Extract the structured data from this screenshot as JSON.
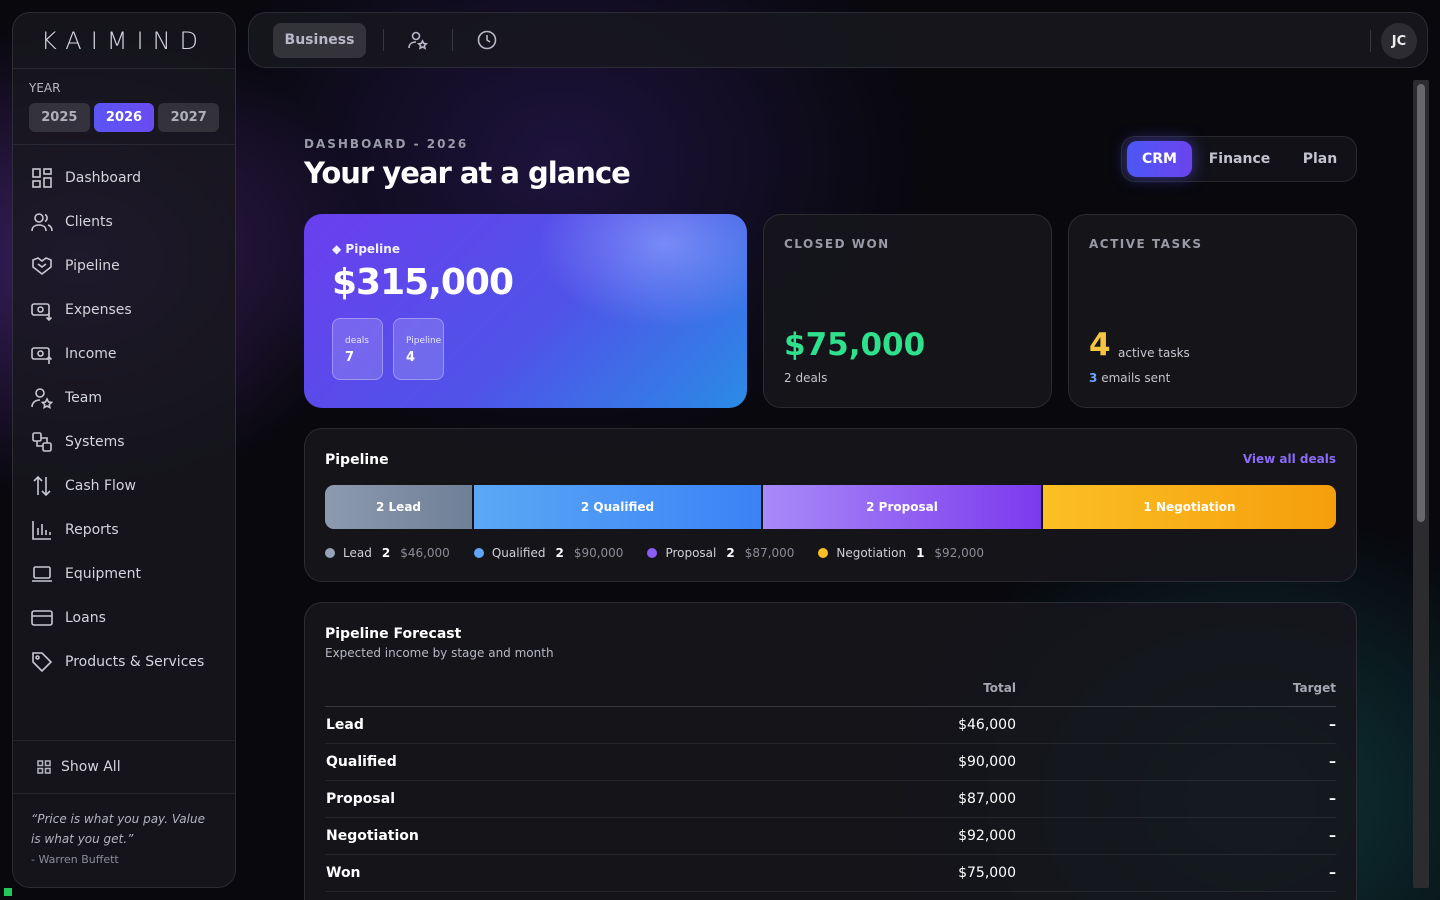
{
  "brand": "KAIMIND",
  "year": {
    "label": "YEAR",
    "options": [
      "2025",
      "2026",
      "2027"
    ],
    "selected": "2026"
  },
  "sidebar": {
    "items": [
      {
        "label": "Dashboard",
        "icon": "grid-icon"
      },
      {
        "label": "Clients",
        "icon": "users-icon"
      },
      {
        "label": "Pipeline",
        "icon": "handshake-icon"
      },
      {
        "label": "Expenses",
        "icon": "cash-out-icon"
      },
      {
        "label": "Income",
        "icon": "cash-in-icon"
      },
      {
        "label": "Team",
        "icon": "team-icon"
      },
      {
        "label": "Systems",
        "icon": "systems-icon"
      },
      {
        "label": "Cash Flow",
        "icon": "arrows-updown-icon"
      },
      {
        "label": "Reports",
        "icon": "bar-chart-icon"
      },
      {
        "label": "Equipment",
        "icon": "laptop-icon"
      },
      {
        "label": "Loans",
        "icon": "credit-card-icon"
      },
      {
        "label": "Products & Services",
        "icon": "tag-icon"
      }
    ],
    "show_all": "Show All",
    "quote": "“Price is what you pay. Value is what you get.”",
    "quote_author": "- Warren Buffett"
  },
  "topbar": {
    "business": "Business",
    "avatar": "JC"
  },
  "header": {
    "eyebrow": "DASHBOARD - 2026",
    "title": "Your year at a glance"
  },
  "view_tabs": {
    "options": [
      "CRM",
      "Finance",
      "Plan"
    ],
    "selected": "CRM"
  },
  "pipeline_card": {
    "label": "◆ Pipeline",
    "value": "$315,000",
    "mini": [
      {
        "label": "deals",
        "value": "7"
      },
      {
        "label": "Pipeline",
        "value": "4"
      }
    ]
  },
  "closed_won": {
    "label": "CLOSED WON",
    "value": "$75,000",
    "sub": "2 deals"
  },
  "active_tasks": {
    "label": "ACTIVE TASKS",
    "value": "4",
    "value_label": "active tasks",
    "emails_count": "3",
    "emails_label": "emails sent"
  },
  "pipeline": {
    "title": "Pipeline",
    "view_all": "View all deals",
    "stages": [
      {
        "bar_label": "2 Lead",
        "name": "Lead",
        "count": "2",
        "amount": "$46,000",
        "color": "#94a3b8"
      },
      {
        "bar_label": "2 Qualified",
        "name": "Qualified",
        "count": "2",
        "amount": "$90,000",
        "color": "#60a5fa"
      },
      {
        "bar_label": "2 Proposal",
        "name": "Proposal",
        "count": "2",
        "amount": "$87,000",
        "color": "#8b5cf6"
      },
      {
        "bar_label": "1 Negotiation",
        "name": "Negotiation",
        "count": "1",
        "amount": "$92,000",
        "color": "#fbbf24"
      }
    ]
  },
  "forecast": {
    "title": "Pipeline Forecast",
    "subtitle": "Expected income by stage and month",
    "columns": [
      "",
      "Total",
      "Target"
    ],
    "rows": [
      {
        "stage": "Lead",
        "total": "$46,000",
        "target": "–"
      },
      {
        "stage": "Qualified",
        "total": "$90,000",
        "target": "–"
      },
      {
        "stage": "Proposal",
        "total": "$87,000",
        "target": "–"
      },
      {
        "stage": "Negotiation",
        "total": "$92,000",
        "target": "–"
      },
      {
        "stage": "Won",
        "total": "$75,000",
        "target": "–"
      }
    ]
  }
}
